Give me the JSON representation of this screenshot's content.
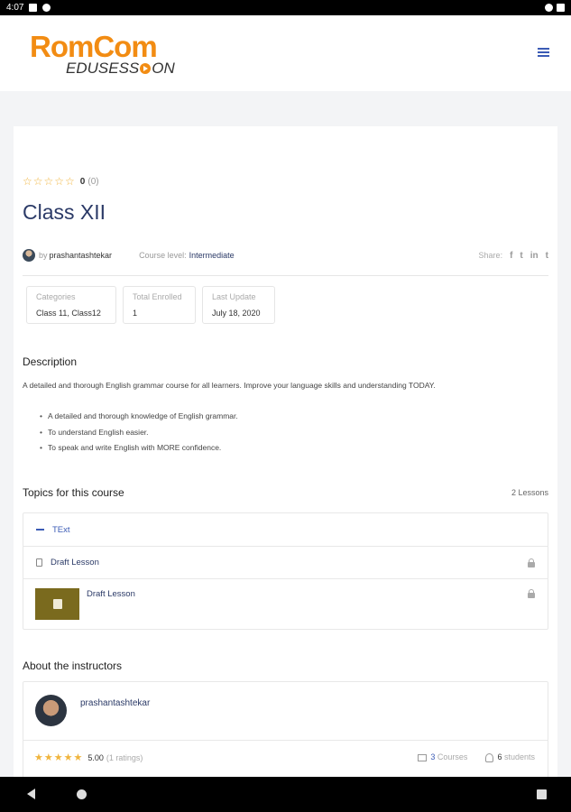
{
  "status_bar": {
    "time": "4:07"
  },
  "header": {
    "logo_top": "RomCom",
    "logo_bottom_a": "EDUSESS",
    "logo_bottom_b": "ON",
    "menu_icon": "hamburger-icon"
  },
  "course": {
    "rating": {
      "stars": "☆☆☆☆☆",
      "value": "0",
      "count": "(0)"
    },
    "title": "Class XII",
    "author_prefix": "by",
    "author": "prashantashtekar",
    "level_label": "Course level:",
    "level_value": "Intermediate",
    "share_label": "Share:",
    "share_icons": [
      "facebook-icon",
      "twitter-icon",
      "linkedin-icon",
      "tumblr-icon"
    ],
    "info": [
      {
        "label": "Categories",
        "value": "Class 11, Class12"
      },
      {
        "label": "Total Enrolled",
        "value": "1"
      },
      {
        "label": "Last Update",
        "value": "July 18, 2020"
      }
    ],
    "description_title": "Description",
    "description": "A detailed and thorough English grammar course for all learners. Improve your language skills and understanding TODAY.",
    "bullets": [
      "A detailed and thorough knowledge of English grammar.",
      "To understand English easier.",
      "To speak and write English with MORE confidence."
    ]
  },
  "topics": {
    "title": "Topics for this course",
    "lessons_count": "2 Lessons",
    "topic_name": "TExt",
    "lessons": [
      {
        "title": "Draft Lesson",
        "locked": true
      },
      {
        "title": "Draft Lesson",
        "locked": true
      }
    ]
  },
  "instructors": {
    "title": "About the instructors",
    "name": "prashantashtekar",
    "stars": "★★★★★",
    "score": "5.00",
    "ratings": "(1 ratings)",
    "courses_num": "3",
    "courses_label": "Courses",
    "students_num": "6",
    "students_label": "students"
  },
  "colors": {
    "accent": "#3b5bb5",
    "title": "#2b3a67",
    "brand_orange": "#f28c13",
    "star": "#f0b43c"
  }
}
